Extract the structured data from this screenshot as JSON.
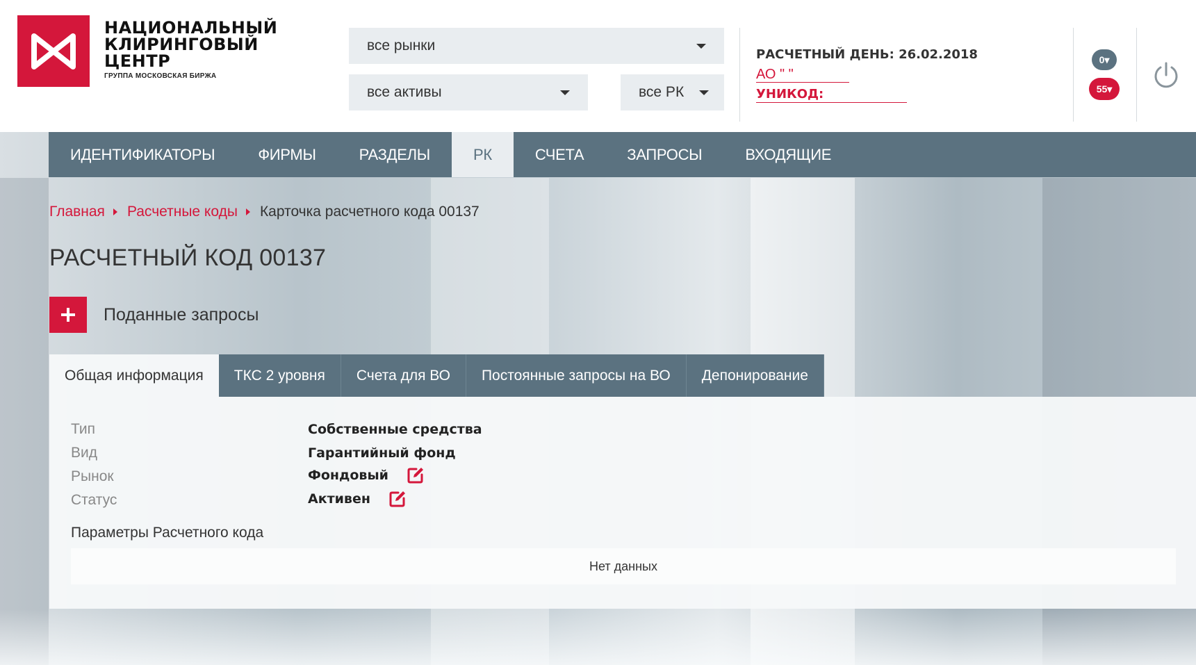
{
  "brand": {
    "logo_lines": [
      "НАЦИОНАЛЬНЫЙ",
      "КЛИРИНГОВЫЙ",
      "ЦЕНТР"
    ],
    "logo_sub": "ГРУППА МОСКОВСКАЯ БИРЖА",
    "accent": "#d4173b",
    "nav_color": "#5b7280"
  },
  "filters": {
    "markets": "все рынки",
    "assets": "все активы",
    "rk": "все РК"
  },
  "account": {
    "day_label": "РАСЧЕТНЫЙ ДЕНЬ: 26.02.2018",
    "org": "АО \"            \"",
    "unicode": "УНИКОД:",
    "badge_grey": "0▾",
    "badge_red": "55▾"
  },
  "nav": {
    "items": [
      {
        "label": "ИДЕНТИФИКАТОРЫ",
        "active": false
      },
      {
        "label": "ФИРМЫ",
        "active": false
      },
      {
        "label": "РАЗДЕЛЫ",
        "active": false
      },
      {
        "label": "РК",
        "active": true
      },
      {
        "label": "СЧЕТА",
        "active": false
      },
      {
        "label": "ЗАПРОСЫ",
        "active": false
      },
      {
        "label": "ВХОДЯЩИЕ",
        "active": false
      }
    ]
  },
  "breadcrumb": {
    "home": "Главная",
    "section": "Расчетные коды",
    "current": "Карточка расчетного кода 00137"
  },
  "page": {
    "title": "РАСЧЕТНЫЙ КОД 00137",
    "submitted_requests": "Поданные запросы"
  },
  "tabs": [
    {
      "label": "Общая информация",
      "active": true
    },
    {
      "label": "ТКС 2 уровня",
      "active": false
    },
    {
      "label": "Счета для ВО",
      "active": false
    },
    {
      "label": "Постоянные запросы на ВО",
      "active": false
    },
    {
      "label": "Депонирование",
      "active": false
    }
  ],
  "info": {
    "type_label": "Тип",
    "type_value": "Собственные средства",
    "kind_label": "Вид",
    "kind_value": "Гарантийный фонд",
    "market_label": "Рынок",
    "market_value": "Фондовый",
    "status_label": "Статус",
    "status_value": "Активен",
    "params_title": "Параметры Расчетного кода",
    "no_data": "Нет данных"
  }
}
